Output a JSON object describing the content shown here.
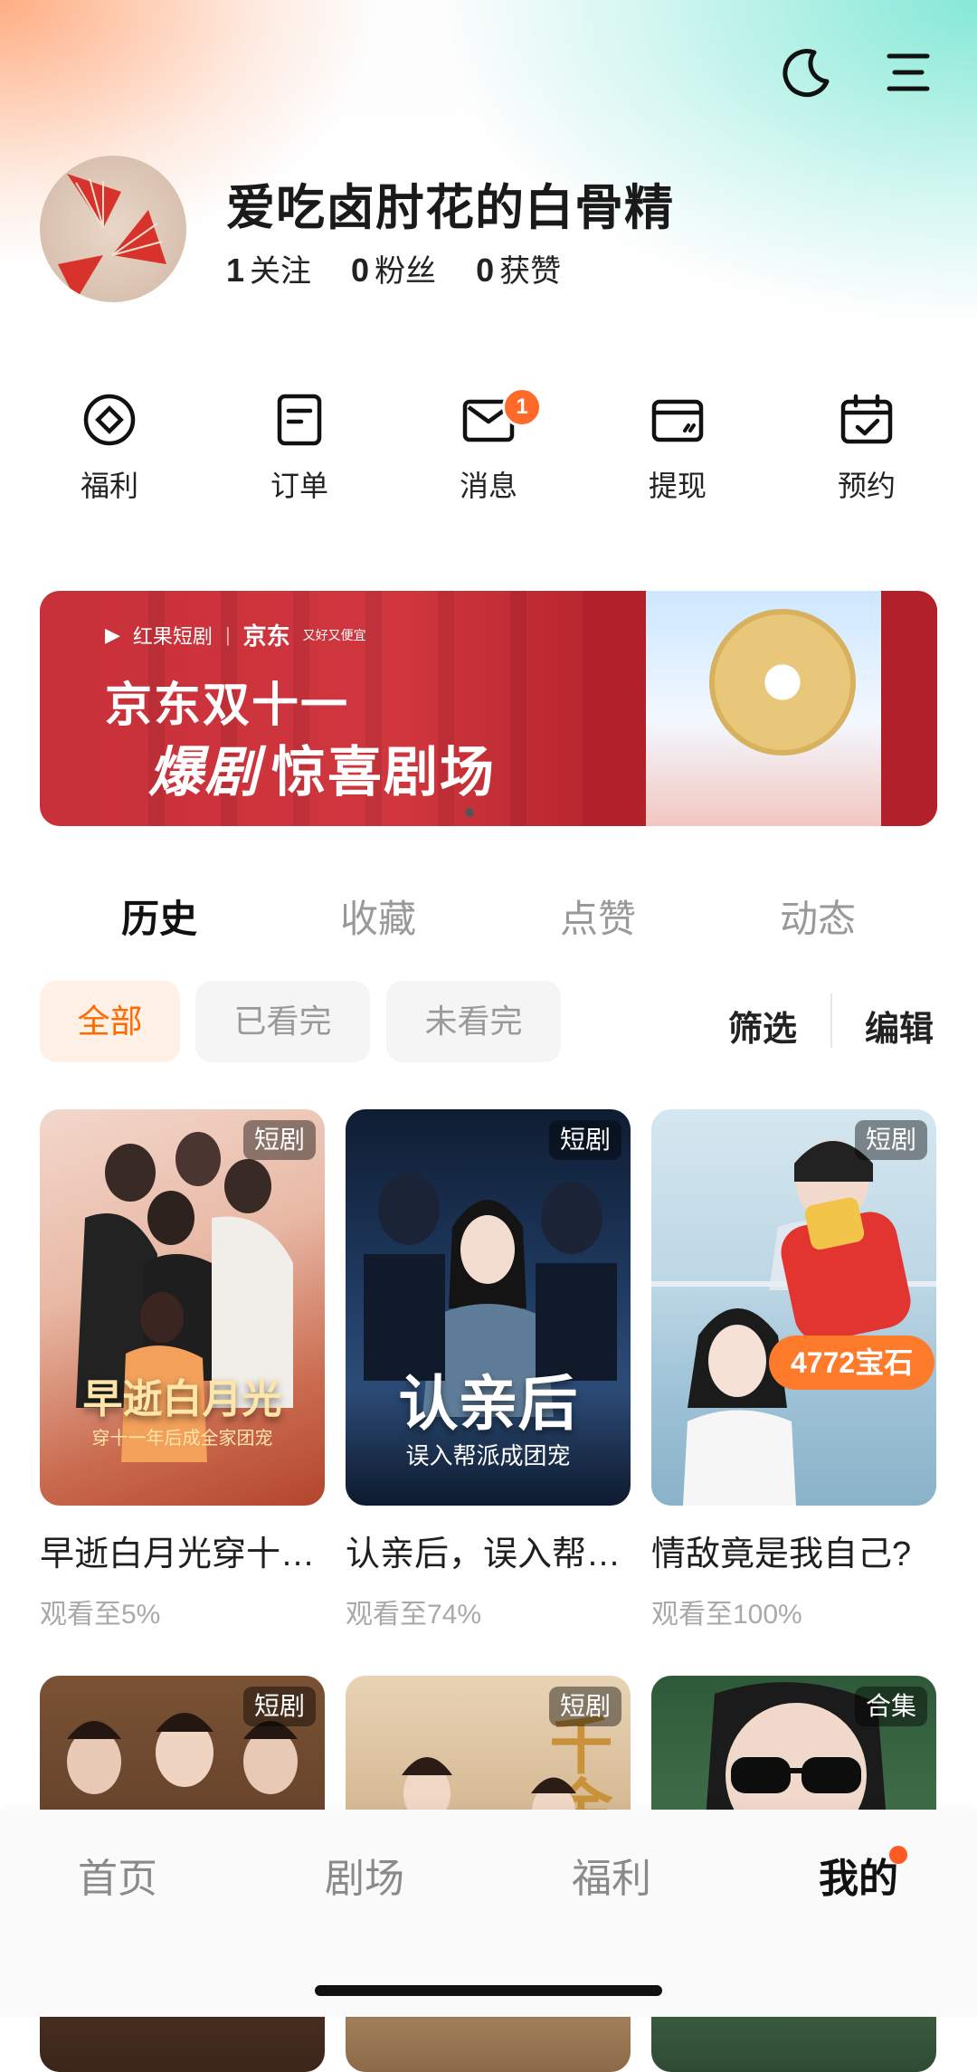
{
  "profile": {
    "name": "爱吃卤肘花的白骨精",
    "stats": [
      {
        "value": "1",
        "label": "关注"
      },
      {
        "value": "0",
        "label": "粉丝"
      },
      {
        "value": "0",
        "label": "获赞"
      }
    ]
  },
  "quick_actions": [
    {
      "label": "福利"
    },
    {
      "label": "订单"
    },
    {
      "label": "消息",
      "badge": "1"
    },
    {
      "label": "提现"
    },
    {
      "label": "预约"
    }
  ],
  "banner": {
    "logo_left": "红果短剧",
    "logo_right": "京东",
    "logo_right_sub": "又好又便宜",
    "line1": "京东双十一",
    "line2_a": "爆剧",
    "line2_b": "惊喜剧场"
  },
  "tabs": [
    "历史",
    "收藏",
    "点赞",
    "动态"
  ],
  "filters": [
    "全部",
    "已看完",
    "未看完"
  ],
  "actions": {
    "filter": "筛选",
    "edit": "编辑"
  },
  "cards": [
    {
      "tag": "短剧",
      "title": "早逝白月光穿十…",
      "progress": "观看至5%",
      "poster_text": "早逝白月光",
      "poster_sub": "穿十一年后成全家团宠"
    },
    {
      "tag": "短剧",
      "title": "认亲后，误入帮…",
      "progress": "观看至74%",
      "poster_text": "认亲后",
      "poster_sub": "误入帮派成团宠"
    },
    {
      "tag": "短剧",
      "title": "情敌竟是我自己?",
      "progress": "观看至100%",
      "gem": "4772宝石"
    },
    {
      "tag": "短剧"
    },
    {
      "tag": "短剧",
      "poster_text": "千金"
    },
    {
      "tag": "合集"
    }
  ],
  "bottom_nav": [
    "首页",
    "剧场",
    "福利",
    "我的"
  ],
  "colors": {
    "accent": "#ff6a00",
    "badge": "#ff6a2a",
    "banner": "#c8303a"
  }
}
